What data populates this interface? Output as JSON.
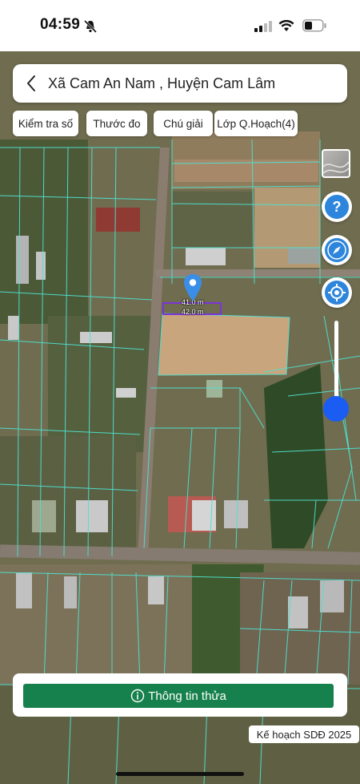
{
  "status": {
    "time": "04:59",
    "icons": [
      "bell-slash-icon",
      "signal-icon",
      "wifi-icon",
      "battery-icon"
    ]
  },
  "header": {
    "back_icon": "chevron-left-icon",
    "title": "Xã Cam An Nam , Huyện Cam Lâm"
  },
  "toolbar": {
    "chips": [
      "Kiểm tra số",
      "Thước đo",
      "Chú giải",
      "Lớp Q.Hoạch(4)"
    ]
  },
  "map_tools": {
    "layer_icon": "satellite-layer-icon",
    "help_icon": "question-icon",
    "compass_icon": "compass-icon",
    "locate_icon": "locate-icon",
    "slider_value": 0.15
  },
  "measurement": {
    "label_top": "41.0 m",
    "label_bottom": "42.0 m"
  },
  "bottom": {
    "button_label": "Thông tin thửa",
    "plan_label": "Kế hoạch SDĐ 2025"
  },
  "colors": {
    "accent_green": "#16814c",
    "slider_blue": "#1b5cf2",
    "marker_blue": "#3b8ee8",
    "parcel_lines": "#4fe0d0",
    "measure_purple": "#7a35d6"
  }
}
